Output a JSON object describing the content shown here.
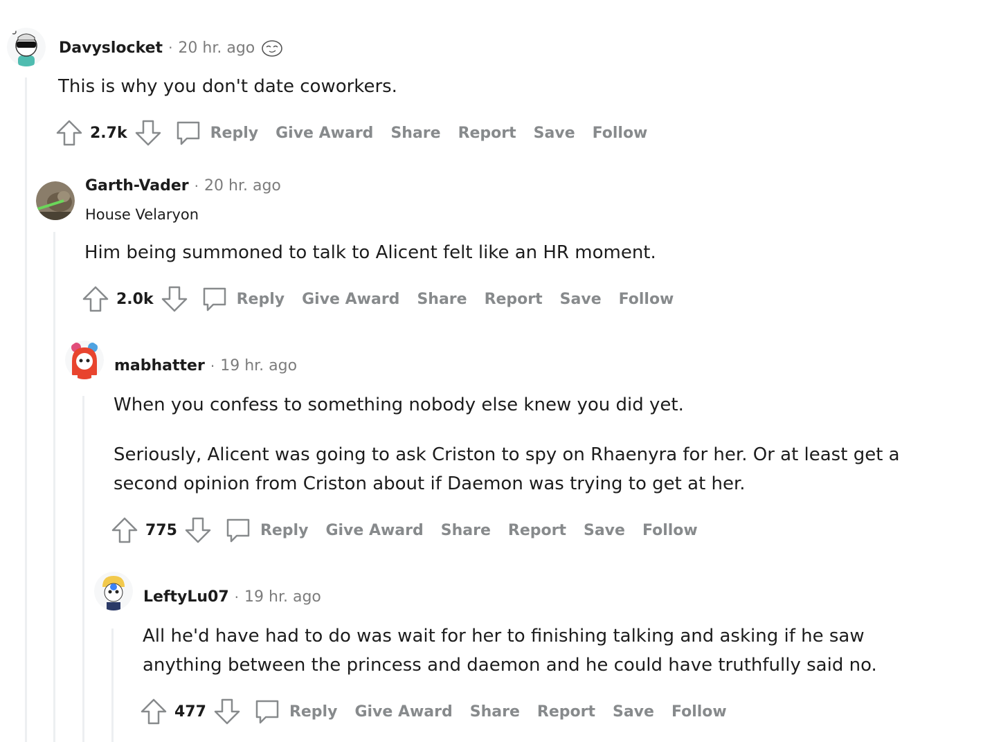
{
  "comments": [
    {
      "author": "Davyslocket",
      "time": "20 hr. ago",
      "flair": "",
      "body": [
        "This is why you don't date coworkers."
      ],
      "score": "2.7k",
      "award_icon": "award-icon"
    },
    {
      "author": "Garth-Vader",
      "time": "20 hr. ago",
      "flair": "House Velaryon",
      "body": [
        "Him being summoned to talk to Alicent felt like an HR moment."
      ],
      "score": "2.0k"
    },
    {
      "author": "mabhatter",
      "time": "19 hr. ago",
      "flair": "",
      "body": [
        "When you confess to something nobody else knew you did yet.",
        "Seriously, Alicent was going to ask Criston to spy on Rhaenyra for her. Or at least get a second opinion from Criston about if Daemon was trying to get at her."
      ],
      "score": "775"
    },
    {
      "author": "LeftyLu07",
      "time": "19 hr. ago",
      "flair": "",
      "body": [
        "All he'd have had to do was wait for her to finishing talking and asking if he saw anything between the princess and daemon and he could have truthfully said no."
      ],
      "score": "477"
    }
  ],
  "actions": {
    "separator": "·",
    "reply": "Reply",
    "give_award": "Give Award",
    "share": "Share",
    "report": "Report",
    "save": "Save",
    "follow": "Follow"
  },
  "colors": {
    "text": "#1c1c1c",
    "meta": "#7c7c7c",
    "action": "#878a8c",
    "thread_line": "#edeff1"
  }
}
